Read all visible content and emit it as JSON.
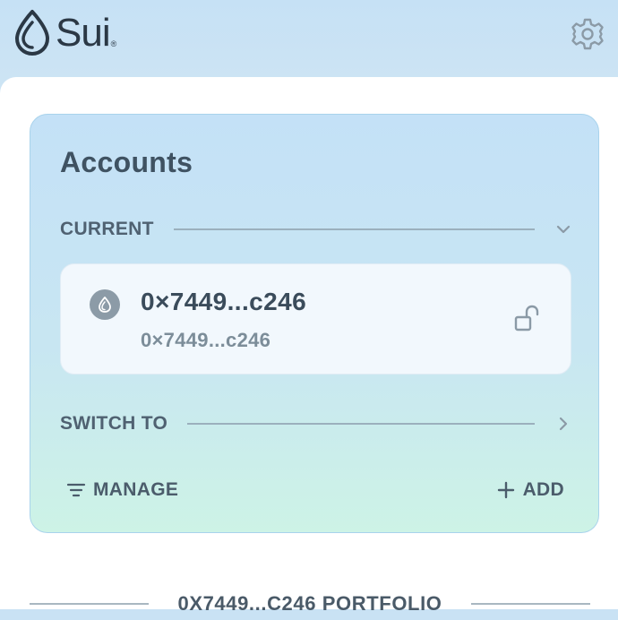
{
  "header": {
    "logo_text": "Sui",
    "logo_registered": "®",
    "settings_icon": "gear-icon"
  },
  "accounts_card": {
    "title": "Accounts",
    "current_section": {
      "label": "CURRENT",
      "toggle_icon": "chevron-down-icon"
    },
    "current_account": {
      "avatar_icon": "sui-drop-icon",
      "name": "0×7449...c246",
      "address": "0×7449...c246",
      "lock_icon": "unlock-icon"
    },
    "switch_section": {
      "label": "SWITCH TO",
      "toggle_icon": "chevron-right-icon"
    },
    "actions": {
      "manage_label": "MANAGE",
      "manage_icon": "filter-lines-icon",
      "add_label": "ADD",
      "add_icon": "plus-icon"
    }
  },
  "portfolio": {
    "heading": "0X7449...C246 PORTFOLIO"
  },
  "colors": {
    "header_bg": "#c6e1f5",
    "card_border": "#a9d3ec",
    "card_gradient_top": "#c4e1f7",
    "card_gradient_bottom": "#cdf3e6",
    "text_primary": "#3b4c5b",
    "text_secondary": "#7c8d99"
  }
}
